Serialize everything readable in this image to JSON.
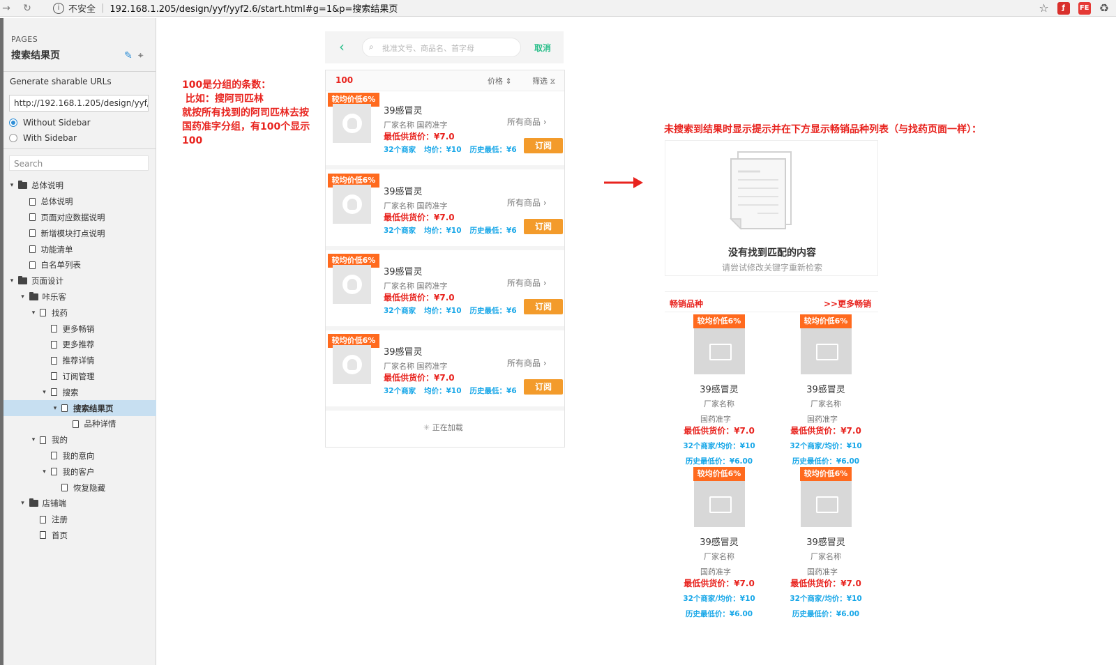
{
  "browser": {
    "insecure": "不安全",
    "url": "192.168.1.205/design/yyf/yyf2.6/start.html#g=1&p=搜索结果页"
  },
  "sidebar": {
    "pages_label": "PAGES",
    "title": "搜索结果页",
    "generate_label": "Generate sharable URLs",
    "url_value": "http://192.168.1.205/design/yyf/yyf2.",
    "radio_without": "Without Sidebar",
    "radio_with": "With Sidebar",
    "search_placeholder": "Search",
    "tree": [
      {
        "label": "总体说明",
        "type": "folder",
        "level": 0
      },
      {
        "label": "总体说明",
        "type": "page",
        "level": 1
      },
      {
        "label": "页面对应数据说明",
        "type": "page",
        "level": 1
      },
      {
        "label": "新增模块打点说明",
        "type": "page",
        "level": 1
      },
      {
        "label": "功能清单",
        "type": "page",
        "level": 1
      },
      {
        "label": "白名单列表",
        "type": "page",
        "level": 1
      },
      {
        "label": "页面设计",
        "type": "folder",
        "level": 0
      },
      {
        "label": "咔乐客",
        "type": "folder",
        "level": 1
      },
      {
        "label": "找药",
        "type": "page-parent",
        "level": 2
      },
      {
        "label": "更多畅销",
        "type": "page",
        "level": 3
      },
      {
        "label": "更多推荐",
        "type": "page",
        "level": 3
      },
      {
        "label": "推荐详情",
        "type": "page",
        "level": 3
      },
      {
        "label": "订阅管理",
        "type": "page",
        "level": 3
      },
      {
        "label": "搜索",
        "type": "page-parent",
        "level": 3
      },
      {
        "label": "搜索结果页",
        "type": "page-parent",
        "level": 4,
        "selected": true
      },
      {
        "label": "品种详情",
        "type": "page",
        "level": 5
      },
      {
        "label": "我的",
        "type": "page-parent",
        "level": 2
      },
      {
        "label": "我的意向",
        "type": "page",
        "level": 3
      },
      {
        "label": "我的客户",
        "type": "page-parent",
        "level": 3
      },
      {
        "label": "恢复隐藏",
        "type": "page",
        "level": 4
      },
      {
        "label": "店铺端",
        "type": "folder",
        "level": 1
      },
      {
        "label": "注册",
        "type": "page",
        "level": 2
      },
      {
        "label": "首页",
        "type": "page",
        "level": 2
      }
    ]
  },
  "annotations": {
    "left": [
      "100是分组的条数：",
      " 比如：搜阿司匹林",
      "就按所有找到的阿司匹林去按",
      "国药准字分组，有100个显示",
      "100"
    ],
    "right": "未搜索到结果时显示提示并在下方显示畅销品种列表（与找药页面一样）："
  },
  "phone": {
    "search_placeholder": "批准文号、商品名、首字母",
    "cancel": "取消",
    "count": "100",
    "sort_price": "价格 ⇕",
    "filter": "筛选 ⧖",
    "items": [
      {
        "badge": "较均价低6%",
        "name": "39感冒灵",
        "info": "厂家名称 国药准字",
        "all": "所有商品 ›",
        "price": "最低供货价：¥7.0",
        "merchants": "32个商家",
        "avg": "均价：¥10",
        "hist": "历史最低：¥6",
        "btn": "订阅"
      },
      {
        "badge": "较均价低6%",
        "name": "39感冒灵",
        "info": "厂家名称 国药准字",
        "all": "所有商品 ›",
        "price": "最低供货价：¥7.0",
        "merchants": "32个商家",
        "avg": "均价：¥10",
        "hist": "历史最低：¥6",
        "btn": "订阅"
      },
      {
        "badge": "较均价低6%",
        "name": "39感冒灵",
        "info": "厂家名称 国药准字",
        "all": "所有商品 ›",
        "price": "最低供货价：¥7.0",
        "merchants": "32个商家",
        "avg": "均价：¥10",
        "hist": "历史最低：¥6",
        "btn": "订阅"
      },
      {
        "badge": "较均价低6%",
        "name": "39感冒灵",
        "info": "厂家名称 国药准字",
        "all": "所有商品 ›",
        "price": "最低供货价：¥7.0",
        "merchants": "32个商家",
        "avg": "均价：¥10",
        "hist": "历史最低：¥6",
        "btn": "订阅"
      }
    ],
    "loading": "正在加载"
  },
  "empty": {
    "title": "没有找到匹配的内容",
    "subtitle": "请尝试修改关键字重新检索"
  },
  "hot": {
    "title": "畅销品种",
    "more": ">>更多畅销",
    "cards": [
      {
        "badge": "较均价低6%",
        "name": "39感冒灵",
        "factory": "厂家名称",
        "approval": "国药准字",
        "price": "最低供货价：¥7.0",
        "stat": "32个商家/均价：¥10",
        "hist": "历史最低价：¥6.00"
      },
      {
        "badge": "较均价低6%",
        "name": "39感冒灵",
        "factory": "厂家名称",
        "approval": "国药准字",
        "price": "最低供货价：¥7.0",
        "stat": "32个商家/均价：¥10",
        "hist": "历史最低价：¥6.00"
      },
      {
        "badge": "较均价低6%",
        "name": "39感冒灵",
        "factory": "厂家名称",
        "approval": "国药准字",
        "price": "最低供货价：¥7.0",
        "stat": "32个商家/均价：¥10",
        "hist": "历史最低价：¥6.00"
      },
      {
        "badge": "较均价低6%",
        "name": "39感冒灵",
        "factory": "厂家名称",
        "approval": "国药准字",
        "price": "最低供货价：¥7.0",
        "stat": "32个商家/均价：¥10",
        "hist": "历史最低价：¥6.00"
      }
    ]
  }
}
